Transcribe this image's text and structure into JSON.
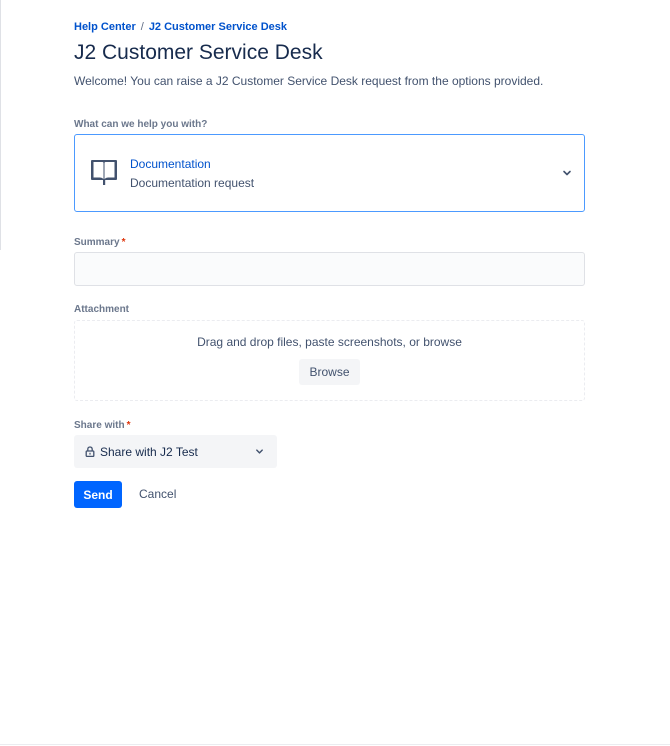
{
  "breadcrumb": {
    "items": [
      "Help Center",
      "J2 Customer Service Desk"
    ],
    "separator": "/"
  },
  "page": {
    "title": "J2 Customer Service Desk",
    "welcome": "Welcome! You can raise a J2 Customer Service Desk request from the options provided."
  },
  "request_type": {
    "label": "What can we help you with?",
    "selected_name": "Documentation",
    "selected_description": "Documentation request",
    "icon": "book-icon"
  },
  "summary": {
    "label": "Summary",
    "required_mark": "*",
    "value": ""
  },
  "attachment": {
    "label": "Attachment",
    "dropzone_text": "Drag and drop files, paste screenshots, or browse",
    "browse_label": "Browse"
  },
  "share": {
    "label": "Share with",
    "required_mark": "*",
    "selected": "Share with J2 Test",
    "icon": "lock-icon"
  },
  "actions": {
    "send_label": "Send",
    "cancel_label": "Cancel"
  },
  "colors": {
    "link": "#0052cc",
    "primary_button": "#0065ff",
    "focus_border": "#4c9aff",
    "required": "#de350b"
  }
}
